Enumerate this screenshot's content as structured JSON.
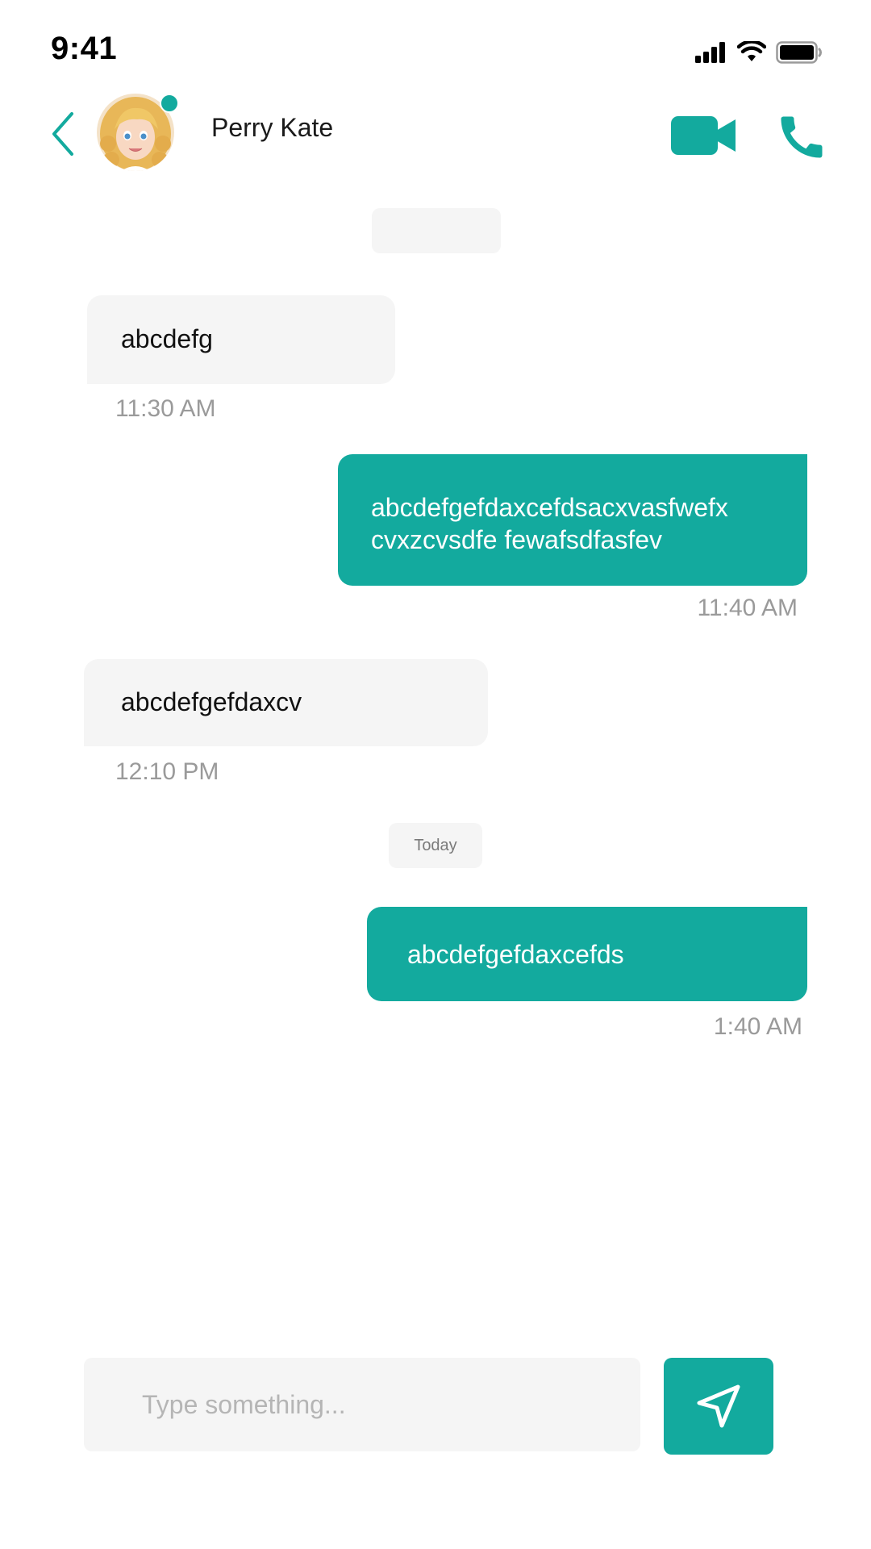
{
  "status_bar": {
    "time": "9:41"
  },
  "header": {
    "contact_name": "Perry Kate",
    "online": true,
    "icons": {
      "back": "chevron-left-icon",
      "video": "video-camera-icon",
      "call": "phone-icon"
    }
  },
  "conversation": {
    "top_date_chip": "",
    "messages": [
      {
        "direction": "in",
        "text": "abcdefg",
        "time": "11:30 AM"
      },
      {
        "direction": "out",
        "text": "abcdefgefdaxcefdsacxvasfwefx cvxzcvsdfe fewafsdfasfev",
        "time": "11:40 AM"
      },
      {
        "direction": "in",
        "text": "abcdefgefdaxcv",
        "time": "12:10 PM"
      },
      {
        "direction": "out",
        "text": "abcdefgefdaxcefds",
        "time": "1:40 AM"
      }
    ],
    "day_separator": "Today"
  },
  "composer": {
    "placeholder": "Type something...",
    "value": "",
    "send_icon": "send-icon"
  },
  "colors": {
    "accent": "#13aa9e",
    "incoming_bubble": "#f5f5f5",
    "timestamp": "#9a9a9a"
  }
}
